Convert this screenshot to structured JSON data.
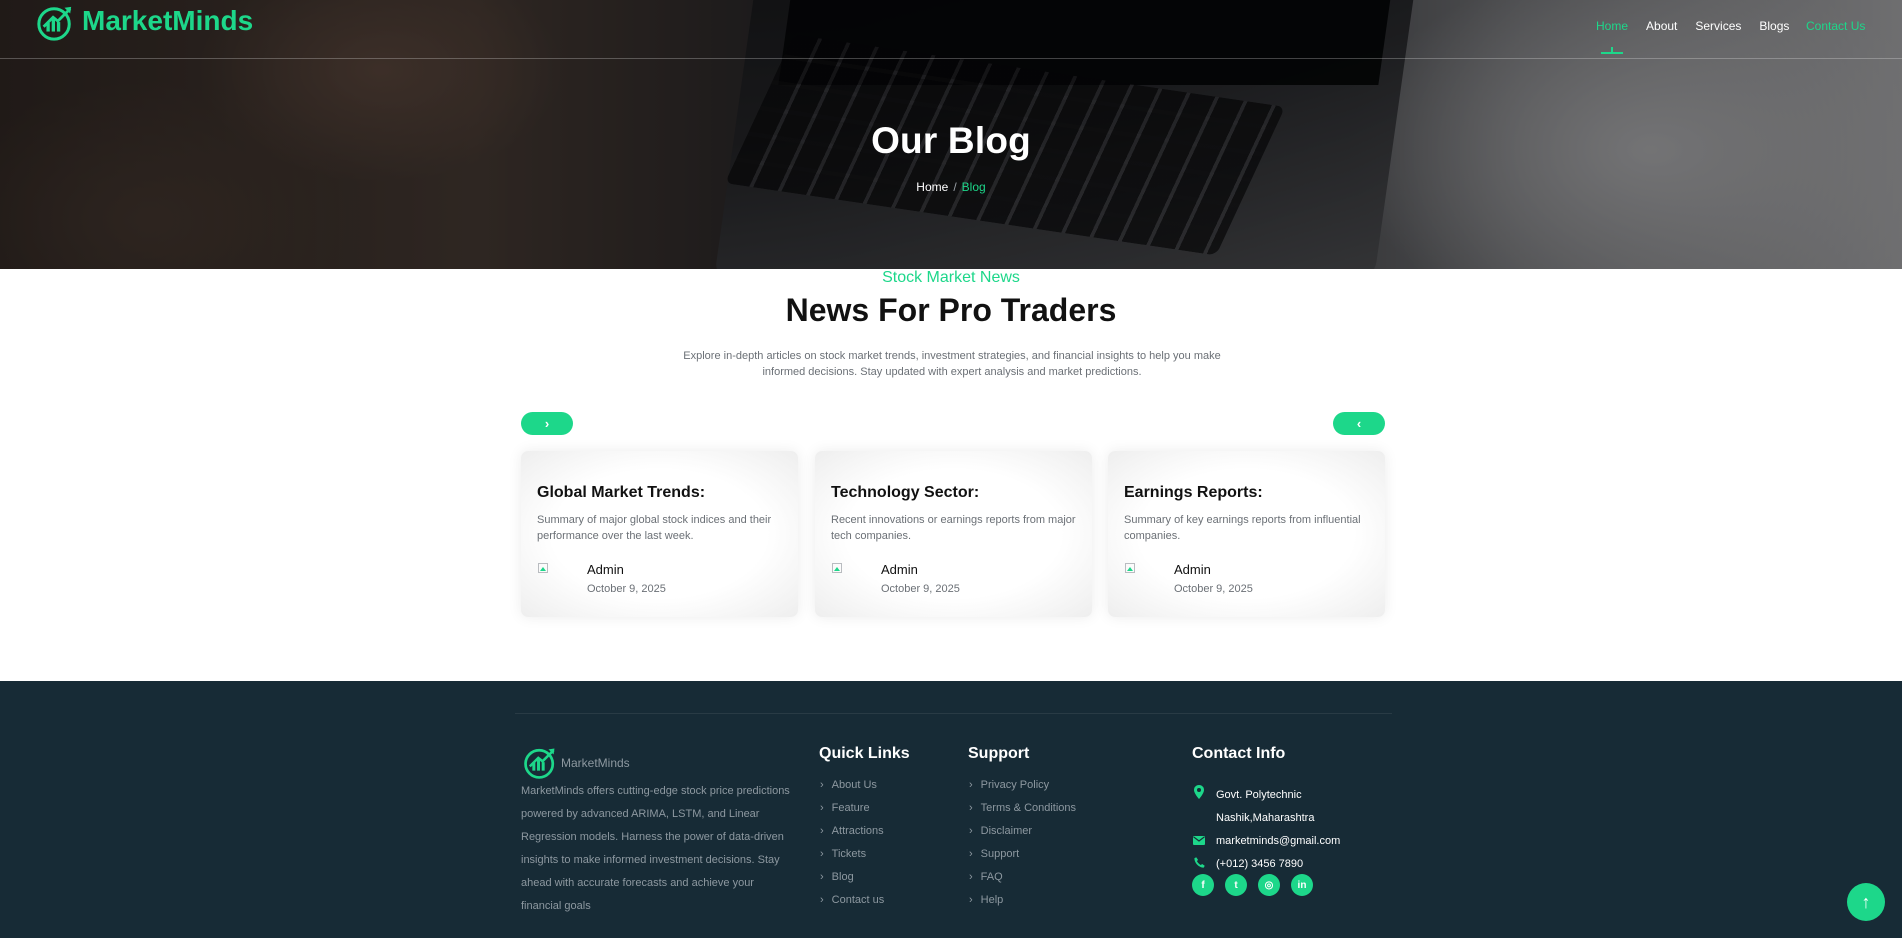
{
  "brand": {
    "name": "MarketMinds",
    "accent": "#1dd78a",
    "footer_bg": "#172b36"
  },
  "nav": {
    "items": [
      {
        "label": "Home",
        "active": true
      },
      {
        "label": "About",
        "active": false
      },
      {
        "label": "Services",
        "active": false
      },
      {
        "label": "Blogs",
        "active": false
      }
    ],
    "contact_label": "Contact Us"
  },
  "hero": {
    "title": "Our Blog",
    "breadcrumb": {
      "home": "Home",
      "separator": "/",
      "current": "Blog"
    }
  },
  "news": {
    "eyebrow": "Stock Market News",
    "title": "News For Pro Traders",
    "description": "Explore in-depth articles on stock market trends, investment strategies, and financial insights to help you make informed decisions. Stay updated with expert analysis and market predictions.",
    "next_icon": "chevron-right-icon",
    "prev_icon": "chevron-left-icon",
    "cards": [
      {
        "title": "Global Market Trends:",
        "text": "Summary of major global stock indices and their performance over the last week.",
        "author": "Admin",
        "date": "October 9, 2025"
      },
      {
        "title": "Technology Sector:",
        "text": "Recent innovations or earnings reports from major tech companies.",
        "author": "Admin",
        "date": "October 9, 2025"
      },
      {
        "title": "Earnings Reports:",
        "text": "Summary of key earnings reports from influential companies.",
        "author": "Admin",
        "date": "October 9, 2025"
      }
    ]
  },
  "footer": {
    "brand": "MarketMinds",
    "description": "MarketMinds offers cutting-edge stock price predictions powered by advanced ARIMA, LSTM, and Linear Regression models. Harness the power of data-driven insights to make informed investment decisions. Stay ahead with accurate forecasts and achieve your financial goals",
    "quick_links": {
      "heading": "Quick Links",
      "items": [
        "About Us",
        "Feature",
        "Attractions",
        "Tickets",
        "Blog",
        "Contact us"
      ]
    },
    "support": {
      "heading": "Support",
      "items": [
        "Privacy Policy",
        "Terms & Conditions",
        "Disclaimer",
        "Support",
        "FAQ",
        "Help"
      ]
    },
    "contact": {
      "heading": "Contact Info",
      "address_line1": "Govt. Polytechnic",
      "address_line2": "Nashik,Maharashtra",
      "email": "marketminds@gmail.com",
      "phone": "(+012) 3456 7890",
      "icons": [
        "map-pin-icon",
        "envelope-icon",
        "phone-icon"
      ]
    },
    "socials": [
      {
        "name": "facebook-icon",
        "glyph": "f"
      },
      {
        "name": "twitter-icon",
        "glyph": "t"
      },
      {
        "name": "instagram-icon",
        "glyph": "◎"
      },
      {
        "name": "linkedin-icon",
        "glyph": "in"
      }
    ]
  },
  "back_to_top_icon": "arrow-up-icon"
}
